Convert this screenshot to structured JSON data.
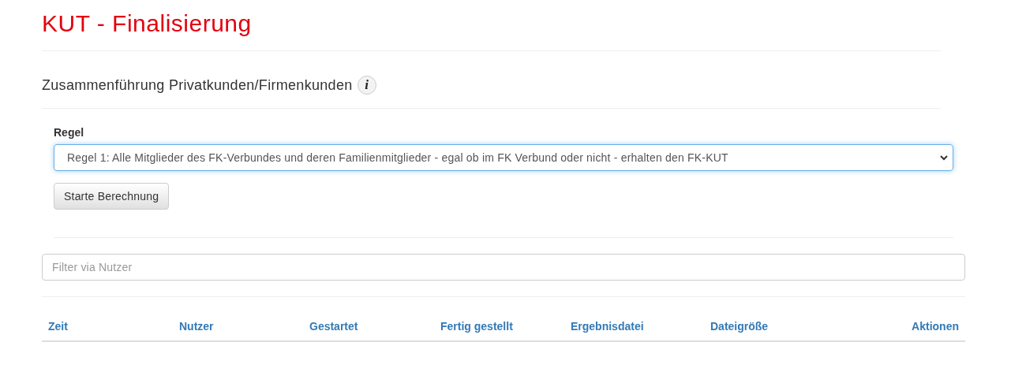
{
  "title": "KUT - Finalisierung",
  "section": {
    "title": "Zusammenführung Privatkunden/Firmenkunden",
    "info_icon": "i"
  },
  "rule_select": {
    "label": "Regel",
    "value": "Regel 1: Alle Mitglieder des FK-Verbundes und deren Familienmitglieder - egal ob im FK Verbund oder nicht - erhalten den FK-KUT"
  },
  "start_button": "Starte Berechnung",
  "filter": {
    "placeholder": "Filter via Nutzer"
  },
  "table": {
    "columns": [
      "Zeit",
      "Nutzer",
      "Gestartet",
      "Fertig gestellt",
      "Ergebnisdatei",
      "Dateigröße",
      "Aktionen"
    ]
  }
}
